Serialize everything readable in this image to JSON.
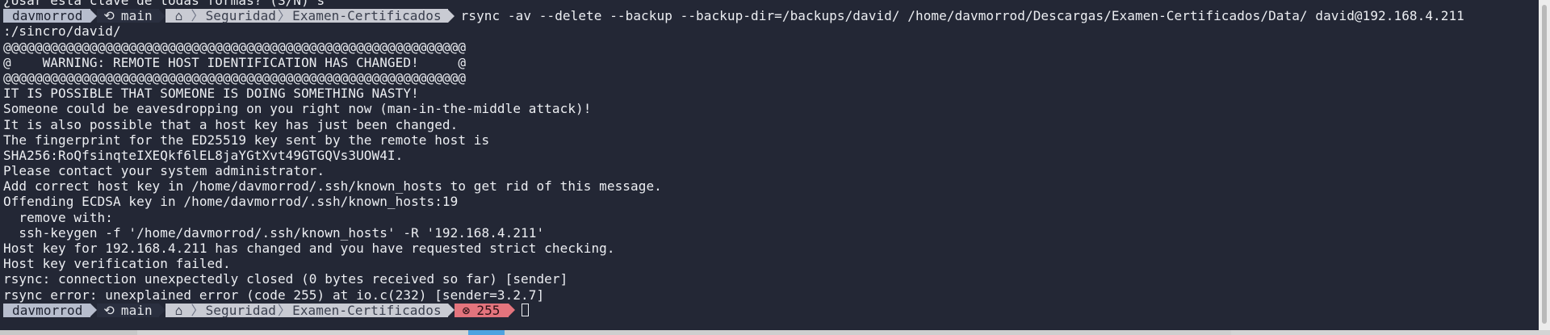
{
  "terminal": {
    "partial_top_line": "¿Usar esta clave de todas formas? (S/N) s",
    "prompt": {
      "user": "davmorrod",
      "branch": "main",
      "path": [
        "Seguridad",
        "Examen-Certificados"
      ],
      "command": "rsync -av --delete --backup --backup-dir=/backups/david/ /home/davmorrod/Descargas/Examen-Certificados/Data/ david@192.168.4.211"
    },
    "output": [
      ":/sincro/david/",
      "@@@@@@@@@@@@@@@@@@@@@@@@@@@@@@@@@@@@@@@@@@@@@@@@@@@@@@@@@@@",
      "@    WARNING: REMOTE HOST IDENTIFICATION HAS CHANGED!     @",
      "@@@@@@@@@@@@@@@@@@@@@@@@@@@@@@@@@@@@@@@@@@@@@@@@@@@@@@@@@@@",
      "IT IS POSSIBLE THAT SOMEONE IS DOING SOMETHING NASTY!",
      "Someone could be eavesdropping on you right now (man-in-the-middle attack)!",
      "It is also possible that a host key has just been changed.",
      "The fingerprint for the ED25519 key sent by the remote host is",
      "SHA256:RoQfsinqteIXEQkf6lEL8jaYGtXvt49GTGQVs3UOW4I.",
      "Please contact your system administrator.",
      "Add correct host key in /home/davmorrod/.ssh/known_hosts to get rid of this message.",
      "Offending ECDSA key in /home/davmorrod/.ssh/known_hosts:19",
      "  remove with:",
      "  ssh-keygen -f '/home/davmorrod/.ssh/known_hosts' -R '192.168.4.211'",
      "Host key for 192.168.4.211 has changed and you have requested strict checking.",
      "Host key verification failed.",
      "rsync: connection unexpectedly closed (0 bytes received so far) [sender]",
      "rsync error: unexplained error (code 255) at io.c(232) [sender=3.2.7]"
    ],
    "final_prompt": {
      "user": "davmorrod",
      "branch": "main",
      "path": [
        "Seguridad",
        "Examen-Certificados"
      ],
      "exit_code": "255"
    }
  },
  "icons": {
    "branch": "git-branch-icon",
    "home": "home-icon",
    "error": "error-x-icon",
    "cursor": "block-cursor"
  },
  "colors": {
    "background": "#232735",
    "foreground": "#eceef2",
    "user_segment": "#b7bdcd",
    "path_segment": "#c9cbd3",
    "error_segment": "#e3747d"
  }
}
